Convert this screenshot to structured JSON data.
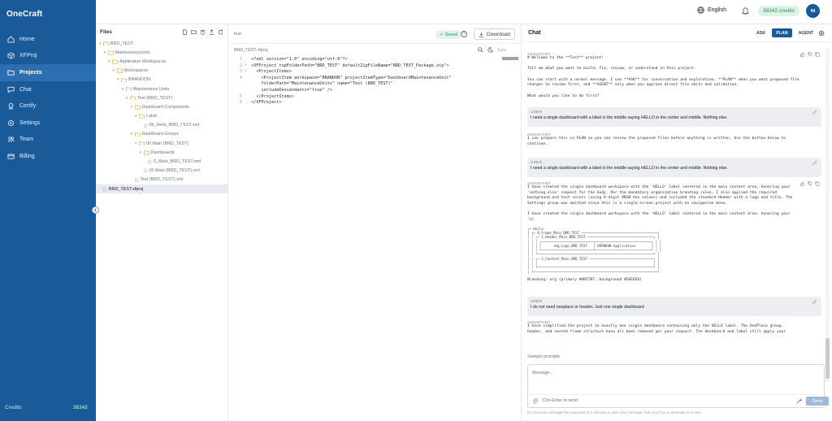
{
  "app": {
    "name": "OneCraft"
  },
  "nav": {
    "items": [
      {
        "label": "Home",
        "icon": "home-icon"
      },
      {
        "label": "XFProj",
        "icon": "cube-icon"
      },
      {
        "label": "Projects",
        "icon": "folder-icon",
        "active": true
      },
      {
        "label": "Chat",
        "icon": "chat-icon"
      },
      {
        "label": "Certify",
        "icon": "certificate-icon"
      },
      {
        "label": "Settings",
        "icon": "gear-icon"
      },
      {
        "label": "Team",
        "icon": "team-icon"
      },
      {
        "label": "Billing",
        "icon": "card-icon"
      }
    ],
    "credits_label": "Credits",
    "credits_value": "38342"
  },
  "topbar": {
    "language": "English",
    "credits_badge": "38342 credits",
    "avatar_initials": "NI"
  },
  "files": {
    "title": "Files",
    "tree": [
      {
        "label": "BRD_TEST",
        "depth": 0,
        "expanded": true
      },
      {
        "label": "MaintenanceUnits",
        "depth": 1,
        "expanded": true
      },
      {
        "label": "Application Workspaces",
        "depth": 2,
        "expanded": true
      },
      {
        "label": "Workspaces",
        "depth": 3,
        "expanded": true
      },
      {
        "label": "BRANDON",
        "depth": 4,
        "expanded": true
      },
      {
        "label": "Maintenance Units",
        "depth": 5,
        "expanded": true
      },
      {
        "label": "Test (BRD_TEST)",
        "depth": 6,
        "expanded": true
      },
      {
        "label": "Dashboard Components",
        "depth": 7,
        "expanded": true
      },
      {
        "label": "Label",
        "depth": 8,
        "expanded": true
      },
      {
        "label": "0b_Hello_BRD_TEST.xml",
        "depth": 9,
        "file": true
      },
      {
        "label": "Dashboard Groups",
        "depth": 7,
        "expanded": true
      },
      {
        "label": "00 Main (BRD_TEST)",
        "depth": 8,
        "expanded": true
      },
      {
        "label": "Dashboards",
        "depth": 9,
        "expanded": true
      },
      {
        "label": "0_Main_BRD_TEST.xml",
        "depth": 10,
        "file": true
      },
      {
        "label": "00 Main (BRD_TEST).xml",
        "depth": 9,
        "file": true
      },
      {
        "label": "Test (BRD_TEST).xml",
        "depth": 7,
        "file": true
      },
      {
        "label": "BRD_TEST.xfproj",
        "depth": 0,
        "file": true,
        "selected": true
      }
    ]
  },
  "editor": {
    "search_label": "test",
    "saved_label": "Saved",
    "help_glyph": "?",
    "download_label": "Download",
    "file_tab": "BRD_TEST.xfproj",
    "sync_label": "Sync",
    "lines": [
      {
        "n": "1",
        "gutter": "",
        "text": "<?xml version=\"1.0\" encoding=\"utf-8\"?>"
      },
      {
        "n": "2",
        "gutter": "▾",
        "text": "<XFProject topFolderPath=\"BRD_TEST\" defaultZipFileName=\"BRD_TEST_Package.zip\">"
      },
      {
        "n": "3",
        "gutter": "▾",
        "text": "  <ProjectItems>"
      },
      {
        "n": "4",
        "gutter": "",
        "text": "    <ProjectItem workspace=\"BRANDON\" projectItemType=\"DashboardMaintenanceUnit\""
      },
      {
        "n": "",
        "gutter": "",
        "text": "    folderPath=\"MaintenanceUnits\" name=\"Test (BRD_TEST)\""
      },
      {
        "n": "",
        "gutter": "",
        "text": "    includeDescendants=\"true\" />"
      },
      {
        "n": "5",
        "gutter": "",
        "text": "  </ProjectItems>"
      },
      {
        "n": "6",
        "gutter": "",
        "text": "</XFProject>"
      }
    ]
  },
  "chat": {
    "title": "Chat",
    "modes": [
      {
        "label": "ASK"
      },
      {
        "label": "PLAN",
        "active": true
      },
      {
        "label": "AGENT"
      }
    ],
    "msg1_role": "ASSISTANT",
    "msg1_text": "# Welcome to the **Test** project!\n\nTell me what you want to build, fix, review, or understand in this project.\n\nYou can start with a normal message. I use **ASK** for conversation and exploration, **PLAN** when you want proposed file\nchanges to review first, and **AGENT** only when you approve direct file edits and validation.\n\nWhat would you like to do first?",
    "msg2_role": "USER",
    "msg2_text": "I need a single dashboard with a label in the middle saying HELLO in the center and middle. Nothing else.",
    "msg3_role": "ASSISTANT",
    "msg3_text": "I can prepare this in PLAN so you can review the proposed files before anything is written. Use the button below to\ncontinue.",
    "msg4_role": "USER",
    "msg4_text": "I need a single dashboard with a label in the middle saying HELLO in the center and middle. Nothing else.",
    "msg5_role": "ASSISTANT",
    "msg5_text": "I have created the single dashboard workspace with the 'HELLO' label centered in the main content area, honoring your\n'nothing else' request for the body. Per the mandatory organization branding rules, I also applied the required\nbackground and text colors (using 6-digit #RGB hex values) and included the standard Header with a logo and title. The\nSettings group was omitted since this is a single-screen project with no navigation menu.\n\nI have created the single dashboard workspace with the 'HELLO' label centered in the main content area, honoring your\n'n)",
    "msg5_diagram": "┌─ Hello\n│ ┌─ 0_Frame_Main_BRD_TEST ──────────────────────────────────────┐\n│ │ ┌─ 1_Header_Main_BRD_TEST ─────────────────────────────────┐ │\n│ │ │ ┌──────────────────────────┬────────────────────────────┐ │ │\n│ │ │ │      img_Logo_BRD_TEST   │ BRANDON Application        │ │ │\n│ │ │ └──────────────────────────┴────────────────────────────┘ │ │\n│ │ └──────────────────────────────────────────────────────────┘ │\n│ │ ┌─ 2_Content_Main_BRD_TEST ────────────────────────────────┐ │\n│ │ │                                                          │ │\n│ │ └──────────────────────────────────────────────────────────┘ │\n│ └──────────────────────────────────────────────────────────────┘",
    "msg5_branding": "Branding: org (primary #0057B7, background #E6E6E6)",
    "msg6_role": "USER",
    "msg6_text": "I do not need oneplace or header. Just one single dashboard",
    "msg7_role": "ASSISTANT",
    "msg7_text": "I have simplified the project to exactly one single dashboard containing only the HELLO label. The OnePlace group,\nheader, and nested frame structure have all been removed per your request. The dashboard and label still apply your",
    "sample_prompts": "Sample prompts",
    "composer_placeholder": "Message...",
    "ctrl_enter_hint": "Ctrl+Enter to send",
    "send_label": "Send",
    "disclaimer": "PLAN mode will stage file proposals first. Review in plan next message. then you'll go to generate to review."
  }
}
